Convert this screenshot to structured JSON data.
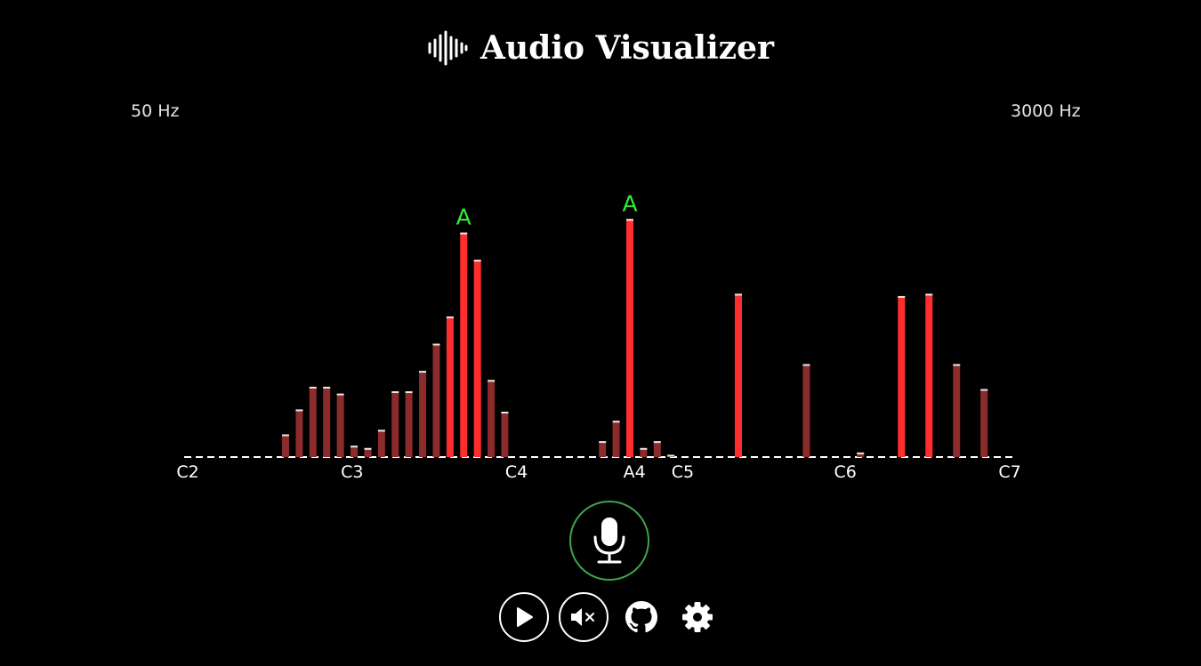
{
  "app": {
    "title": "Audio Visualizer",
    "logo_icon": "sound-wave-icon"
  },
  "frequency_range": {
    "min_label": "50 Hz",
    "max_label": "3000 Hz"
  },
  "controls": {
    "mic_icon": "microphone-icon",
    "mic_active_color": "#3fa34d",
    "play_icon": "play-icon",
    "mute_icon": "volume-mute-icon",
    "github_icon": "github-icon",
    "settings_icon": "gear-icon"
  },
  "colors": {
    "bar_strong": "#ff2d2d",
    "bar_weak": "#8b2b2b",
    "bar_cap": "#e8e8e8",
    "note_label": "#33ee33",
    "baseline_dash": "#ffffff"
  },
  "chart_data": {
    "type": "bar",
    "x_scale": "log",
    "x_range_hz": [
      65.41,
      2093.0
    ],
    "y_range": [
      0,
      1
    ],
    "octave_labels": [
      {
        "label": "C2",
        "hz": 65.41
      },
      {
        "label": "C3",
        "hz": 130.81
      },
      {
        "label": "C4",
        "hz": 261.63
      },
      {
        "label": "A4",
        "hz": 440.0
      },
      {
        "label": "C5",
        "hz": 523.25
      },
      {
        "label": "C6",
        "hz": 1046.5
      },
      {
        "label": "C7",
        "hz": 2093.0
      }
    ],
    "peak_note_labels": [
      {
        "label": "A",
        "bar_index": 11
      },
      {
        "label": "A",
        "bar_index": 18
      }
    ],
    "bars": [
      {
        "hz": 98.8,
        "value": 0.1
      },
      {
        "hz": 104.7,
        "value": 0.21
      },
      {
        "hz": 110.9,
        "value": 0.31
      },
      {
        "hz": 117.5,
        "value": 0.31
      },
      {
        "hz": 124.5,
        "value": 0.28
      },
      {
        "hz": 131.9,
        "value": 0.05
      },
      {
        "hz": 139.8,
        "value": 0.04
      },
      {
        "hz": 148.1,
        "value": 0.12
      },
      {
        "hz": 156.9,
        "value": 0.29
      },
      {
        "hz": 166.2,
        "value": 0.29
      },
      {
        "hz": 176.1,
        "value": 0.38
      },
      {
        "hz": 186.6,
        "value": 0.5
      },
      {
        "hz": 197.7,
        "value": 0.62
      },
      {
        "hz": 209.4,
        "value": 0.99
      },
      {
        "hz": 221.9,
        "value": 0.87
      },
      {
        "hz": 235.1,
        "value": 0.34
      },
      {
        "hz": 249.0,
        "value": 0.2
      },
      {
        "hz": 375.9,
        "value": 0.07
      },
      {
        "hz": 398.2,
        "value": 0.16
      },
      {
        "hz": 421.9,
        "value": 1.05
      },
      {
        "hz": 446.9,
        "value": 0.04
      },
      {
        "hz": 473.5,
        "value": 0.07
      },
      {
        "hz": 501.7,
        "value": 0.01
      },
      {
        "hz": 666.6,
        "value": 0.72
      },
      {
        "hz": 888.1,
        "value": 0.41
      },
      {
        "hz": 1115.5,
        "value": 0.02
      },
      {
        "hz": 1325.9,
        "value": 0.71
      },
      {
        "hz": 1489.1,
        "value": 0.72
      },
      {
        "hz": 1672.7,
        "value": 0.41
      },
      {
        "hz": 1878.5,
        "value": 0.3
      }
    ]
  }
}
